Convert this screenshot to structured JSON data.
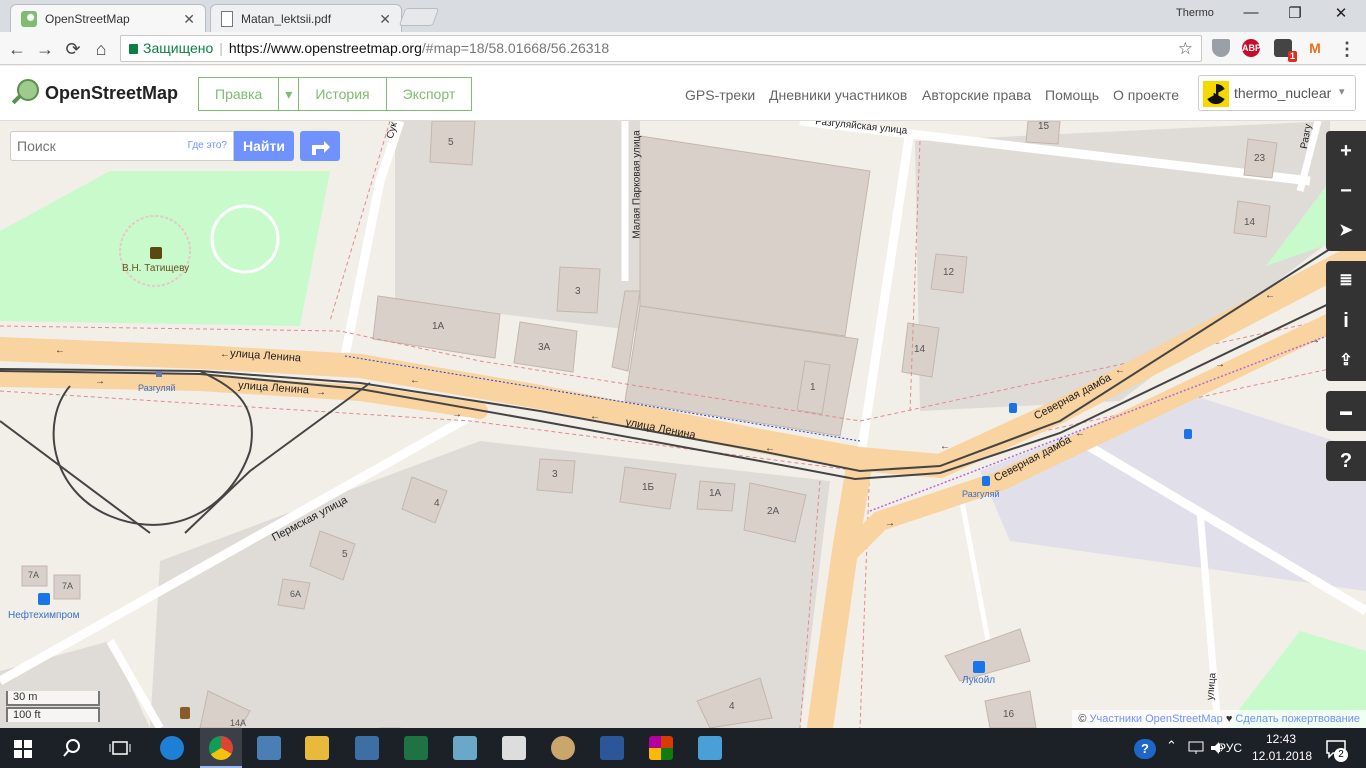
{
  "browser": {
    "tabs": [
      {
        "title": "OpenStreetMap",
        "active": true
      },
      {
        "title": "Matan_lektsii.pdf",
        "active": false
      }
    ],
    "window_user": "Thermo",
    "window_controls": {
      "minimize": "—",
      "restore": "❐",
      "close": "✕"
    },
    "nav": {
      "back": "←",
      "forward": "→",
      "reload": "⟳",
      "home": "⌂"
    },
    "address": {
      "secure_label": "Защищено",
      "url_host": "https://www.openstreetmap.org",
      "url_rest": "/#map=18/58.01668/56.26318",
      "star": "☆"
    },
    "extensions": [
      {
        "name": "shield-icon",
        "label": "",
        "color": "#9aa0a6"
      },
      {
        "name": "adblock-icon",
        "label": "ABP",
        "color": "#c70d2c"
      },
      {
        "name": "notification-icon",
        "label": "1",
        "color": "#444444"
      },
      {
        "name": "gmail-icon",
        "label": "M",
        "color": "#e8711a"
      }
    ],
    "menu": "⋮"
  },
  "osm": {
    "logo_text": "OpenStreetMap",
    "edit_buttons": [
      "Правка",
      "▾",
      "История",
      "Экспорт"
    ],
    "nav_links": [
      "GPS-треки",
      "Дневники участников",
      "Авторские права",
      "Помощь",
      "О проекте"
    ],
    "user": {
      "name": "thermo_nuclear",
      "caret": "▾"
    },
    "accent": "#7ebc6f",
    "button_blue": "#7092ff"
  },
  "map": {
    "search": {
      "placeholder": "Поиск",
      "where_label": "Где это?",
      "submit": "Найти"
    },
    "controls": [
      {
        "name": "zoom-in-button",
        "glyph": "+"
      },
      {
        "name": "zoom-out-button",
        "glyph": "−"
      },
      {
        "name": "locate-button",
        "glyph": "➤"
      },
      {
        "name": "layers-button",
        "glyph": "≣"
      },
      {
        "name": "info-button",
        "glyph": "i"
      },
      {
        "name": "share-button",
        "glyph": "⇪"
      },
      {
        "name": "note-button",
        "glyph": "▬"
      },
      {
        "name": "help-button",
        "glyph": "?"
      }
    ],
    "scale": {
      "metric": "30 m",
      "imperial": "100 ft"
    },
    "attribution": {
      "prefix": "©",
      "contributors": "Участники OpenStreetMap",
      "heart": "♥",
      "donate": "Сделать пожертвование"
    },
    "labels": {
      "monument": "В.Н. Татищеву",
      "lenina1": "улица Ленина",
      "lenina2": "улица Ленина",
      "lenina3": "улица Ленина",
      "razgulyay_stop": "Разгуляй",
      "razgulyay_stop2": "Разгуляй",
      "permskaya": "Пермская улица",
      "malaya_parkovaya": "Малая Парковая улица",
      "razgulyayskaya": "Разгуляйская улица",
      "severnaya1": "Северная дамба",
      "severnaya2": "Северная дамба",
      "neftekhimprom": "Нефтехимпром",
      "lukoil": "Лукойл",
      "suk": "Сук",
      "razgul_right": "Разгу",
      "ulitsa_right": "улица"
    },
    "house_numbers": [
      "5",
      "3",
      "1А",
      "3А",
      "1",
      "15",
      "23",
      "14",
      "12",
      "14",
      "3",
      "1Б",
      "1А",
      "2А",
      "4",
      "5",
      "6А",
      "7А",
      "7А",
      "14А",
      "4",
      "16"
    ]
  },
  "taskbar": {
    "language": "РУС",
    "time": "12:43",
    "date": "12.01.2018",
    "notifications": "2"
  }
}
